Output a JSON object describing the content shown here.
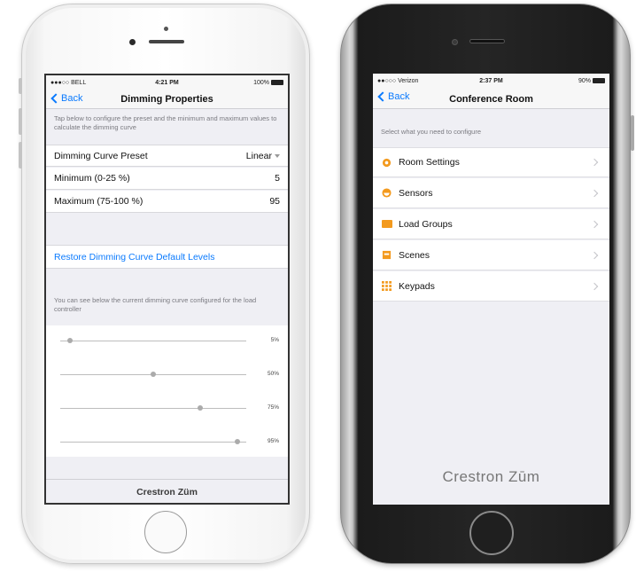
{
  "left_phone": {
    "status": {
      "carrier": "●●●○○ BELL",
      "time": "4:21 PM",
      "battery": "100%"
    },
    "nav": {
      "back_label": "Back",
      "title": "Dimming Properties"
    },
    "intro_note": "Tap below to configure the preset and the minimum and maximum values to calculate the dimming curve",
    "settings": [
      {
        "label": "Dimming Curve Preset",
        "value": "Linear"
      },
      {
        "label": "Minimum (0-25 %)",
        "value": "5"
      },
      {
        "label": "Maximum (75-100 %)",
        "value": "95"
      }
    ],
    "restore_label": "Restore Dimming Curve Default Levels",
    "curve_note": "You can see below the current dimming curve configured for the load controller",
    "sliders": [
      {
        "label": "5%",
        "level": 0.05
      },
      {
        "label": "50%",
        "level": 0.5
      },
      {
        "label": "75%",
        "level": 0.75
      },
      {
        "label": "95%",
        "level": 0.95
      }
    ],
    "footer_brand": "Crestron Züm"
  },
  "right_phone": {
    "status": {
      "carrier": "●●○○○ Verizon",
      "time": "2:37 PM",
      "battery": "90%"
    },
    "nav": {
      "back_label": "Back",
      "title": "Conference Room"
    },
    "intro_note": "Select what you need to configure",
    "menu": [
      {
        "label": "Room Settings",
        "icon": "gear-icon"
      },
      {
        "label": "Sensors",
        "icon": "sensor-icon"
      },
      {
        "label": "Load Groups",
        "icon": "folder-icon"
      },
      {
        "label": "Scenes",
        "icon": "scene-icon"
      },
      {
        "label": "Keypads",
        "icon": "keypad-icon"
      }
    ],
    "brand": "Crestron Zūm"
  },
  "colors": {
    "accent_blue": "#0a7afe",
    "icon_orange": "#f39a1e",
    "screen_bg": "#efeff4"
  }
}
